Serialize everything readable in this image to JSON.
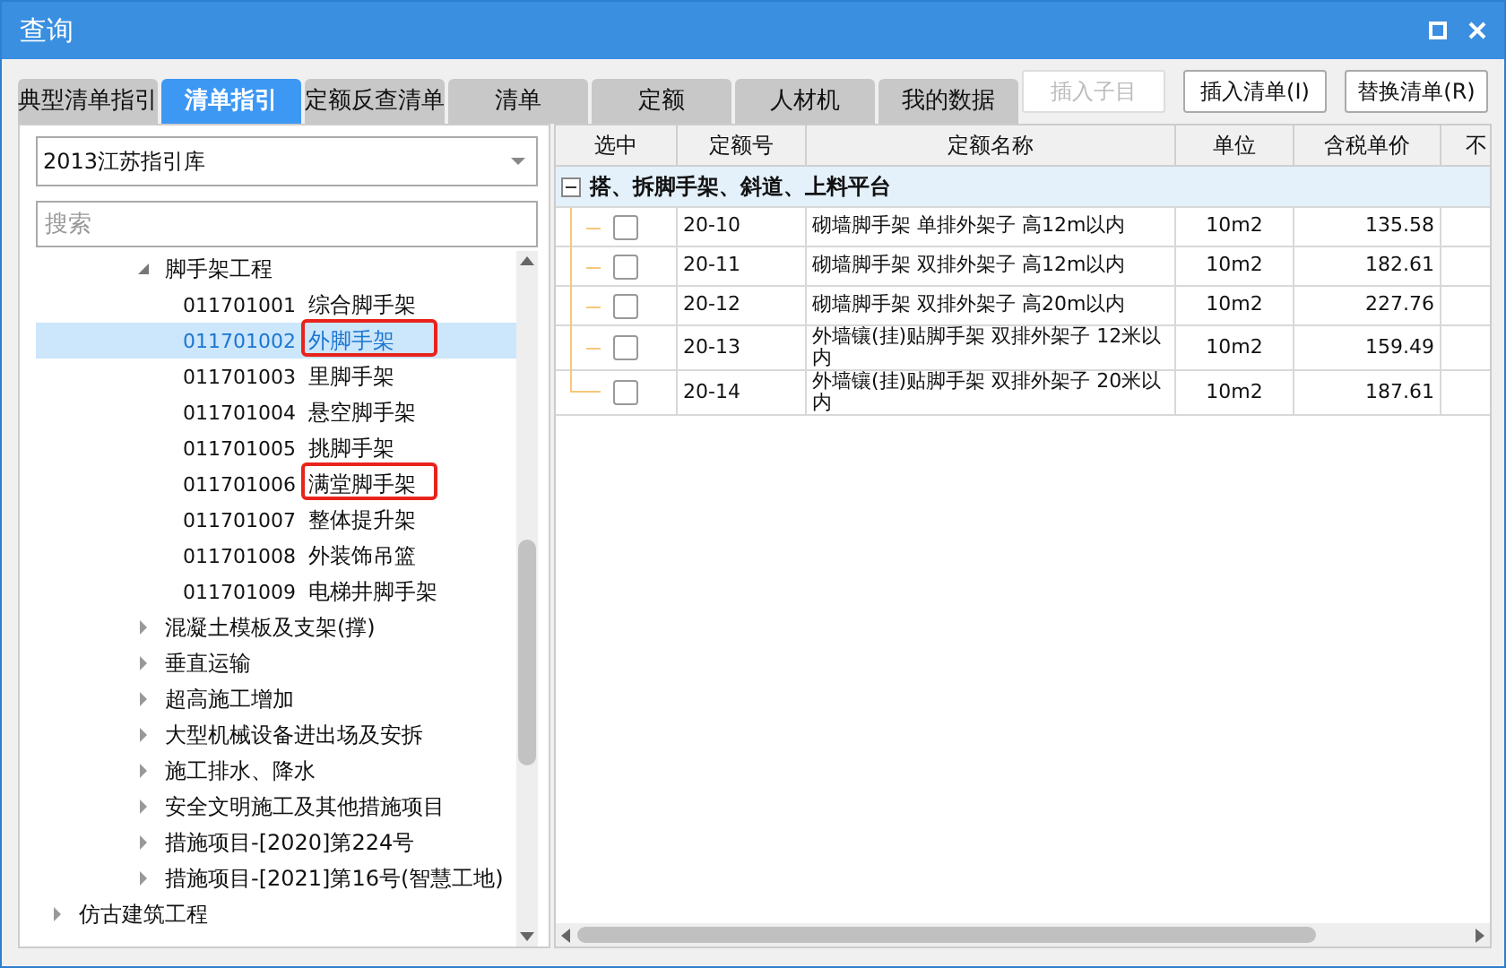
{
  "window": {
    "title": "查询"
  },
  "tabs": [
    {
      "label": "典型清单指引",
      "selected": false
    },
    {
      "label": "清单指引",
      "selected": true
    },
    {
      "label": "定额反查清单",
      "selected": false
    },
    {
      "label": "清单",
      "selected": false
    },
    {
      "label": "定额",
      "selected": false
    },
    {
      "label": "人材机",
      "selected": false
    },
    {
      "label": "我的数据",
      "selected": false
    }
  ],
  "buttons": [
    {
      "label": "插入子目",
      "disabled": true
    },
    {
      "label": "插入清单(I)",
      "disabled": false
    },
    {
      "label": "替换清单(R)",
      "disabled": false
    }
  ],
  "library_select": {
    "value": "2013江苏指引库"
  },
  "search": {
    "placeholder": "搜索"
  },
  "tree": [
    {
      "children": [
        {
          "label": "脚手架工程",
          "expanded": true,
          "children": [
            {
              "code": "011701001",
              "label": "综合脚手架",
              "selected": false,
              "marked": false
            },
            {
              "code": "011701002",
              "label": "外脚手架",
              "selected": true,
              "marked": true
            },
            {
              "code": "011701003",
              "label": "里脚手架",
              "selected": false,
              "marked": false
            },
            {
              "code": "011701004",
              "label": "悬空脚手架",
              "selected": false,
              "marked": false
            },
            {
              "code": "011701005",
              "label": "挑脚手架",
              "selected": false,
              "marked": false
            },
            {
              "code": "011701006",
              "label": "满堂脚手架",
              "selected": false,
              "marked": true
            },
            {
              "code": "011701007",
              "label": "整体提升架",
              "selected": false,
              "marked": false
            },
            {
              "code": "011701008",
              "label": "外装饰吊篮",
              "selected": false,
              "marked": false
            },
            {
              "code": "011701009",
              "label": "电梯井脚手架",
              "selected": false,
              "marked": false
            }
          ]
        },
        {
          "label": "混凝土模板及支架(撑)",
          "expanded": false
        },
        {
          "label": "垂直运输",
          "expanded": false
        },
        {
          "label": "超高施工增加",
          "expanded": false
        },
        {
          "label": "大型机械设备进出场及安拆",
          "expanded": false
        },
        {
          "label": "施工排水、降水",
          "expanded": false
        },
        {
          "label": "安全文明施工及其他措施项目",
          "expanded": false
        },
        {
          "label": "措施项目-[2020]第224号",
          "expanded": false
        },
        {
          "label": "措施项目-[2021]第16号(智慧工地)",
          "expanded": false
        }
      ]
    },
    {
      "label": "仿古建筑工程",
      "expanded": false
    }
  ],
  "table": {
    "columns": [
      "选中",
      "定额号",
      "定额名称",
      "单位",
      "含税单价",
      "不"
    ],
    "group": {
      "label": "搭、拆脚手架、斜道、上料平台",
      "expanded": true
    },
    "rows": [
      {
        "checked": false,
        "code": "20-10",
        "name": "砌墙脚手架 单排外架子 高12m以内",
        "unit": "10m2",
        "price": "135.58"
      },
      {
        "checked": false,
        "code": "20-11",
        "name": "砌墙脚手架 双排外架子 高12m以内",
        "unit": "10m2",
        "price": "182.61"
      },
      {
        "checked": false,
        "code": "20-12",
        "name": "砌墙脚手架 双排外架子 高20m以内",
        "unit": "10m2",
        "price": "227.76"
      },
      {
        "checked": false,
        "code": "20-13",
        "name": "外墙镶(挂)贴脚手架 双排外架子 12米以内",
        "unit": "10m2",
        "price": "159.49"
      },
      {
        "checked": false,
        "code": "20-14",
        "name": "外墙镶(挂)贴脚手架 双排外架子 20米以内",
        "unit": "10m2",
        "price": "187.61"
      }
    ]
  }
}
